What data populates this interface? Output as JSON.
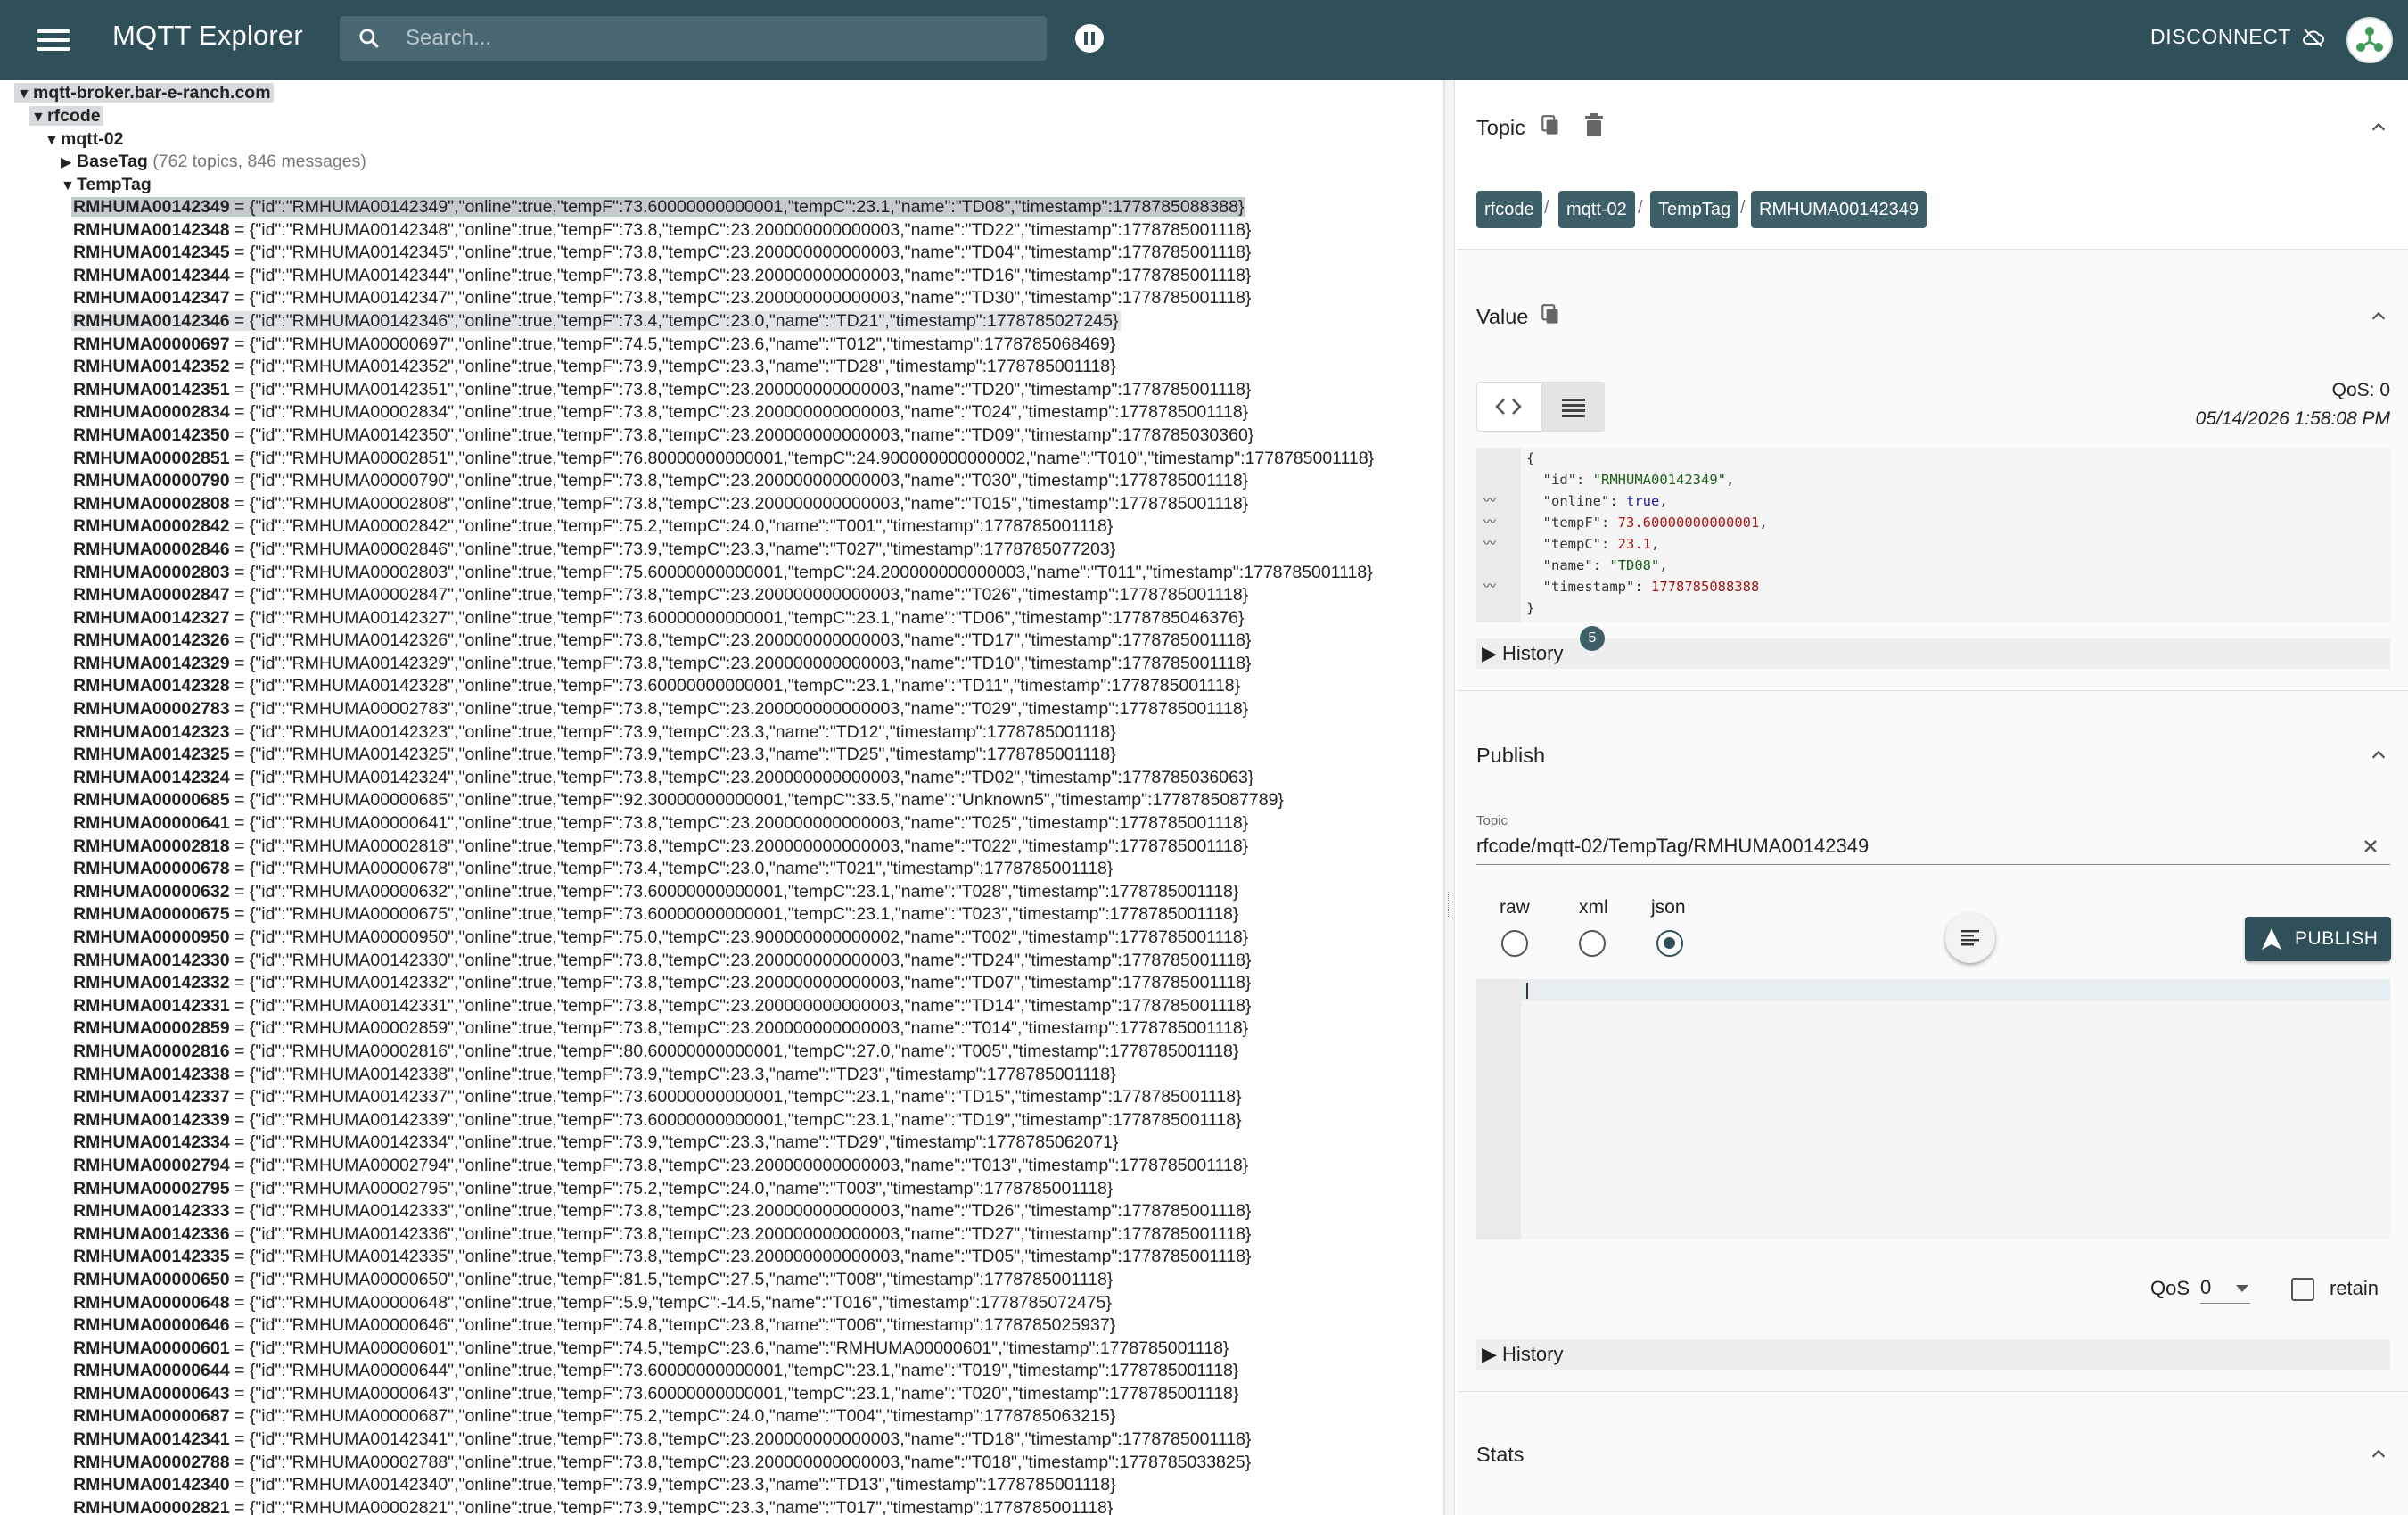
{
  "header": {
    "title": "MQTT Explorer",
    "search_placeholder": "Search...",
    "disconnect_label": "DISCONNECT"
  },
  "tree": {
    "broker": "mqtt-broker.bar-e-ranch.com",
    "level1": "rfcode",
    "level2": "mqtt-02",
    "basetag": {
      "name": "BaseTag",
      "info": "(762 topics, 846 messages)"
    },
    "temptag": "TempTag",
    "rows": [
      {
        "k": "RMHUMA00142349",
        "v": "{\"id\":\"RMHUMA00142349\",\"online\":true,\"tempF\":73.60000000000001,\"tempC\":23.1,\"name\":\"TD08\",\"timestamp\":1778785088388}"
      },
      {
        "k": "RMHUMA00142348",
        "v": "{\"id\":\"RMHUMA00142348\",\"online\":true,\"tempF\":73.8,\"tempC\":23.200000000000003,\"name\":\"TD22\",\"timestamp\":1778785001118}"
      },
      {
        "k": "RMHUMA00142345",
        "v": "{\"id\":\"RMHUMA00142345\",\"online\":true,\"tempF\":73.8,\"tempC\":23.200000000000003,\"name\":\"TD04\",\"timestamp\":1778785001118}"
      },
      {
        "k": "RMHUMA00142344",
        "v": "{\"id\":\"RMHUMA00142344\",\"online\":true,\"tempF\":73.8,\"tempC\":23.200000000000003,\"name\":\"TD16\",\"timestamp\":1778785001118}"
      },
      {
        "k": "RMHUMA00142347",
        "v": "{\"id\":\"RMHUMA00142347\",\"online\":true,\"tempF\":73.8,\"tempC\":23.200000000000003,\"name\":\"TD30\",\"timestamp\":1778785001118}"
      },
      {
        "k": "RMHUMA00142346",
        "v": "{\"id\":\"RMHUMA00142346\",\"online\":true,\"tempF\":73.4,\"tempC\":23.0,\"name\":\"TD21\",\"timestamp\":1778785027245}"
      },
      {
        "k": "RMHUMA00000697",
        "v": "{\"id\":\"RMHUMA00000697\",\"online\":true,\"tempF\":74.5,\"tempC\":23.6,\"name\":\"T012\",\"timestamp\":1778785068469}"
      },
      {
        "k": "RMHUMA00142352",
        "v": "{\"id\":\"RMHUMA00142352\",\"online\":true,\"tempF\":73.9,\"tempC\":23.3,\"name\":\"TD28\",\"timestamp\":1778785001118}"
      },
      {
        "k": "RMHUMA00142351",
        "v": "{\"id\":\"RMHUMA00142351\",\"online\":true,\"tempF\":73.8,\"tempC\":23.200000000000003,\"name\":\"TD20\",\"timestamp\":1778785001118}"
      },
      {
        "k": "RMHUMA00002834",
        "v": "{\"id\":\"RMHUMA00002834\",\"online\":true,\"tempF\":73.8,\"tempC\":23.200000000000003,\"name\":\"T024\",\"timestamp\":1778785001118}"
      },
      {
        "k": "RMHUMA00142350",
        "v": "{\"id\":\"RMHUMA00142350\",\"online\":true,\"tempF\":73.8,\"tempC\":23.200000000000003,\"name\":\"TD09\",\"timestamp\":1778785030360}"
      },
      {
        "k": "RMHUMA00002851",
        "v": "{\"id\":\"RMHUMA00002851\",\"online\":true,\"tempF\":76.80000000000001,\"tempC\":24.900000000000002,\"name\":\"T010\",\"timestamp\":1778785001118}"
      },
      {
        "k": "RMHUMA00000790",
        "v": "{\"id\":\"RMHUMA00000790\",\"online\":true,\"tempF\":73.8,\"tempC\":23.200000000000003,\"name\":\"T030\",\"timestamp\":1778785001118}"
      },
      {
        "k": "RMHUMA00002808",
        "v": "{\"id\":\"RMHUMA00002808\",\"online\":true,\"tempF\":73.8,\"tempC\":23.200000000000003,\"name\":\"T015\",\"timestamp\":1778785001118}"
      },
      {
        "k": "RMHUMA00002842",
        "v": "{\"id\":\"RMHUMA00002842\",\"online\":true,\"tempF\":75.2,\"tempC\":24.0,\"name\":\"T001\",\"timestamp\":1778785001118}"
      },
      {
        "k": "RMHUMA00002846",
        "v": "{\"id\":\"RMHUMA00002846\",\"online\":true,\"tempF\":73.9,\"tempC\":23.3,\"name\":\"T027\",\"timestamp\":1778785077203}"
      },
      {
        "k": "RMHUMA00002803",
        "v": "{\"id\":\"RMHUMA00002803\",\"online\":true,\"tempF\":75.60000000000001,\"tempC\":24.200000000000003,\"name\":\"T011\",\"timestamp\":1778785001118}"
      },
      {
        "k": "RMHUMA00002847",
        "v": "{\"id\":\"RMHUMA00002847\",\"online\":true,\"tempF\":73.8,\"tempC\":23.200000000000003,\"name\":\"T026\",\"timestamp\":1778785001118}"
      },
      {
        "k": "RMHUMA00142327",
        "v": "{\"id\":\"RMHUMA00142327\",\"online\":true,\"tempF\":73.60000000000001,\"tempC\":23.1,\"name\":\"TD06\",\"timestamp\":1778785046376}"
      },
      {
        "k": "RMHUMA00142326",
        "v": "{\"id\":\"RMHUMA00142326\",\"online\":true,\"tempF\":73.8,\"tempC\":23.200000000000003,\"name\":\"TD17\",\"timestamp\":1778785001118}"
      },
      {
        "k": "RMHUMA00142329",
        "v": "{\"id\":\"RMHUMA00142329\",\"online\":true,\"tempF\":73.8,\"tempC\":23.200000000000003,\"name\":\"TD10\",\"timestamp\":1778785001118}"
      },
      {
        "k": "RMHUMA00142328",
        "v": "{\"id\":\"RMHUMA00142328\",\"online\":true,\"tempF\":73.60000000000001,\"tempC\":23.1,\"name\":\"TD11\",\"timestamp\":1778785001118}"
      },
      {
        "k": "RMHUMA00002783",
        "v": "{\"id\":\"RMHUMA00002783\",\"online\":true,\"tempF\":73.8,\"tempC\":23.200000000000003,\"name\":\"T029\",\"timestamp\":1778785001118}"
      },
      {
        "k": "RMHUMA00142323",
        "v": "{\"id\":\"RMHUMA00142323\",\"online\":true,\"tempF\":73.9,\"tempC\":23.3,\"name\":\"TD12\",\"timestamp\":1778785001118}"
      },
      {
        "k": "RMHUMA00142325",
        "v": "{\"id\":\"RMHUMA00142325\",\"online\":true,\"tempF\":73.9,\"tempC\":23.3,\"name\":\"TD25\",\"timestamp\":1778785001118}"
      },
      {
        "k": "RMHUMA00142324",
        "v": "{\"id\":\"RMHUMA00142324\",\"online\":true,\"tempF\":73.8,\"tempC\":23.200000000000003,\"name\":\"TD02\",\"timestamp\":1778785036063}"
      },
      {
        "k": "RMHUMA00000685",
        "v": "{\"id\":\"RMHUMA00000685\",\"online\":true,\"tempF\":92.30000000000001,\"tempC\":33.5,\"name\":\"Unknown5\",\"timestamp\":1778785087789}"
      },
      {
        "k": "RMHUMA00000641",
        "v": "{\"id\":\"RMHUMA00000641\",\"online\":true,\"tempF\":73.8,\"tempC\":23.200000000000003,\"name\":\"T025\",\"timestamp\":1778785001118}"
      },
      {
        "k": "RMHUMA00002818",
        "v": "{\"id\":\"RMHUMA00002818\",\"online\":true,\"tempF\":73.8,\"tempC\":23.200000000000003,\"name\":\"T022\",\"timestamp\":1778785001118}"
      },
      {
        "k": "RMHUMA00000678",
        "v": "{\"id\":\"RMHUMA00000678\",\"online\":true,\"tempF\":73.4,\"tempC\":23.0,\"name\":\"T021\",\"timestamp\":1778785001118}"
      },
      {
        "k": "RMHUMA00000632",
        "v": "{\"id\":\"RMHUMA00000632\",\"online\":true,\"tempF\":73.60000000000001,\"tempC\":23.1,\"name\":\"T028\",\"timestamp\":1778785001118}"
      },
      {
        "k": "RMHUMA00000675",
        "v": "{\"id\":\"RMHUMA00000675\",\"online\":true,\"tempF\":73.60000000000001,\"tempC\":23.1,\"name\":\"T023\",\"timestamp\":1778785001118}"
      },
      {
        "k": "RMHUMA00000950",
        "v": "{\"id\":\"RMHUMA00000950\",\"online\":true,\"tempF\":75.0,\"tempC\":23.900000000000002,\"name\":\"T002\",\"timestamp\":1778785001118}"
      },
      {
        "k": "RMHUMA00142330",
        "v": "{\"id\":\"RMHUMA00142330\",\"online\":true,\"tempF\":73.8,\"tempC\":23.200000000000003,\"name\":\"TD24\",\"timestamp\":1778785001118}"
      },
      {
        "k": "RMHUMA00142332",
        "v": "{\"id\":\"RMHUMA00142332\",\"online\":true,\"tempF\":73.8,\"tempC\":23.200000000000003,\"name\":\"TD07\",\"timestamp\":1778785001118}"
      },
      {
        "k": "RMHUMA00142331",
        "v": "{\"id\":\"RMHUMA00142331\",\"online\":true,\"tempF\":73.8,\"tempC\":23.200000000000003,\"name\":\"TD14\",\"timestamp\":1778785001118}"
      },
      {
        "k": "RMHUMA00002859",
        "v": "{\"id\":\"RMHUMA00002859\",\"online\":true,\"tempF\":73.8,\"tempC\":23.200000000000003,\"name\":\"T014\",\"timestamp\":1778785001118}"
      },
      {
        "k": "RMHUMA00002816",
        "v": "{\"id\":\"RMHUMA00002816\",\"online\":true,\"tempF\":80.60000000000001,\"tempC\":27.0,\"name\":\"T005\",\"timestamp\":1778785001118}"
      },
      {
        "k": "RMHUMA00142338",
        "v": "{\"id\":\"RMHUMA00142338\",\"online\":true,\"tempF\":73.9,\"tempC\":23.3,\"name\":\"TD23\",\"timestamp\":1778785001118}"
      },
      {
        "k": "RMHUMA00142337",
        "v": "{\"id\":\"RMHUMA00142337\",\"online\":true,\"tempF\":73.60000000000001,\"tempC\":23.1,\"name\":\"TD15\",\"timestamp\":1778785001118}"
      },
      {
        "k": "RMHUMA00142339",
        "v": "{\"id\":\"RMHUMA00142339\",\"online\":true,\"tempF\":73.60000000000001,\"tempC\":23.1,\"name\":\"TD19\",\"timestamp\":1778785001118}"
      },
      {
        "k": "RMHUMA00142334",
        "v": "{\"id\":\"RMHUMA00142334\",\"online\":true,\"tempF\":73.9,\"tempC\":23.3,\"name\":\"TD29\",\"timestamp\":1778785062071}"
      },
      {
        "k": "RMHUMA00002794",
        "v": "{\"id\":\"RMHUMA00002794\",\"online\":true,\"tempF\":73.8,\"tempC\":23.200000000000003,\"name\":\"T013\",\"timestamp\":1778785001118}"
      },
      {
        "k": "RMHUMA00002795",
        "v": "{\"id\":\"RMHUMA00002795\",\"online\":true,\"tempF\":75.2,\"tempC\":24.0,\"name\":\"T003\",\"timestamp\":1778785001118}"
      },
      {
        "k": "RMHUMA00142333",
        "v": "{\"id\":\"RMHUMA00142333\",\"online\":true,\"tempF\":73.8,\"tempC\":23.200000000000003,\"name\":\"TD26\",\"timestamp\":1778785001118}"
      },
      {
        "k": "RMHUMA00142336",
        "v": "{\"id\":\"RMHUMA00142336\",\"online\":true,\"tempF\":73.8,\"tempC\":23.200000000000003,\"name\":\"TD27\",\"timestamp\":1778785001118}"
      },
      {
        "k": "RMHUMA00142335",
        "v": "{\"id\":\"RMHUMA00142335\",\"online\":true,\"tempF\":73.8,\"tempC\":23.200000000000003,\"name\":\"TD05\",\"timestamp\":1778785001118}"
      },
      {
        "k": "RMHUMA00000650",
        "v": "{\"id\":\"RMHUMA00000650\",\"online\":true,\"tempF\":81.5,\"tempC\":27.5,\"name\":\"T008\",\"timestamp\":1778785001118}"
      },
      {
        "k": "RMHUMA00000648",
        "v": "{\"id\":\"RMHUMA00000648\",\"online\":true,\"tempF\":5.9,\"tempC\":-14.5,\"name\":\"T016\",\"timestamp\":1778785072475}"
      },
      {
        "k": "RMHUMA00000646",
        "v": "{\"id\":\"RMHUMA00000646\",\"online\":true,\"tempF\":74.8,\"tempC\":23.8,\"name\":\"T006\",\"timestamp\":1778785025937}"
      },
      {
        "k": "RMHUMA00000601",
        "v": "{\"id\":\"RMHUMA00000601\",\"online\":true,\"tempF\":74.5,\"tempC\":23.6,\"name\":\"RMHUMA00000601\",\"timestamp\":1778785001118}"
      },
      {
        "k": "RMHUMA00000644",
        "v": "{\"id\":\"RMHUMA00000644\",\"online\":true,\"tempF\":73.60000000000001,\"tempC\":23.1,\"name\":\"T019\",\"timestamp\":1778785001118}"
      },
      {
        "k": "RMHUMA00000643",
        "v": "{\"id\":\"RMHUMA00000643\",\"online\":true,\"tempF\":73.60000000000001,\"tempC\":23.1,\"name\":\"T020\",\"timestamp\":1778785001118}"
      },
      {
        "k": "RMHUMA00000687",
        "v": "{\"id\":\"RMHUMA00000687\",\"online\":true,\"tempF\":75.2,\"tempC\":24.0,\"name\":\"T004\",\"timestamp\":1778785063215}"
      },
      {
        "k": "RMHUMA00142341",
        "v": "{\"id\":\"RMHUMA00142341\",\"online\":true,\"tempF\":73.8,\"tempC\":23.200000000000003,\"name\":\"TD18\",\"timestamp\":1778785001118}"
      },
      {
        "k": "RMHUMA00002788",
        "v": "{\"id\":\"RMHUMA00002788\",\"online\":true,\"tempF\":73.8,\"tempC\":23.200000000000003,\"name\":\"T018\",\"timestamp\":1778785033825}"
      },
      {
        "k": "RMHUMA00142340",
        "v": "{\"id\":\"RMHUMA00142340\",\"online\":true,\"tempF\":73.9,\"tempC\":23.3,\"name\":\"TD13\",\"timestamp\":1778785001118}"
      },
      {
        "k": "RMHUMA00002821",
        "v": "{\"id\":\"RMHUMA00002821\",\"online\":true,\"tempF\":73.9,\"tempC\":23.3,\"name\":\"T017\",\"timestamp\":1778785001118}"
      }
    ]
  },
  "topic_panel": {
    "title": "Topic",
    "breadcrumb": [
      "rfcode",
      "mqtt-02",
      "TempTag",
      "RMHUMA00142349"
    ],
    "separator": "/"
  },
  "value_panel": {
    "title": "Value",
    "qos": "QoS: 0",
    "timestamp": "05/14/2026 1:58:08 PM",
    "history_label": "History",
    "history_count": "5",
    "json": {
      "open": "{",
      "close": "}",
      "lines": [
        {
          "key": "\"id\"",
          "val": "\"RMHUMA00142349\"",
          "kind": "s",
          "comma": ","
        },
        {
          "key": "\"online\"",
          "val": "true",
          "kind": "b",
          "comma": ","
        },
        {
          "key": "\"tempF\"",
          "val": "73.60000000000001",
          "kind": "n",
          "comma": ","
        },
        {
          "key": "\"tempC\"",
          "val": "23.1",
          "kind": "n",
          "comma": ","
        },
        {
          "key": "\"name\"",
          "val": "\"TD08\"",
          "kind": "s",
          "comma": ","
        },
        {
          "key": "\"timestamp\"",
          "val": "1778785088388",
          "kind": "n",
          "comma": ""
        }
      ]
    }
  },
  "publish_panel": {
    "title": "Publish",
    "topic_label": "Topic",
    "topic_value": "rfcode/mqtt-02/TempTag/RMHUMA00142349",
    "formats": [
      "raw",
      "xml",
      "json"
    ],
    "selected_format": "json",
    "publish_label": "PUBLISH",
    "qos_label": "QoS",
    "qos_value": "0",
    "retain_label": "retain",
    "history_label": "History"
  },
  "stats_panel": {
    "title": "Stats"
  },
  "colors": {
    "appbar": "#2f4f59",
    "chip": "#3d5f68",
    "search": "#4a6872"
  }
}
